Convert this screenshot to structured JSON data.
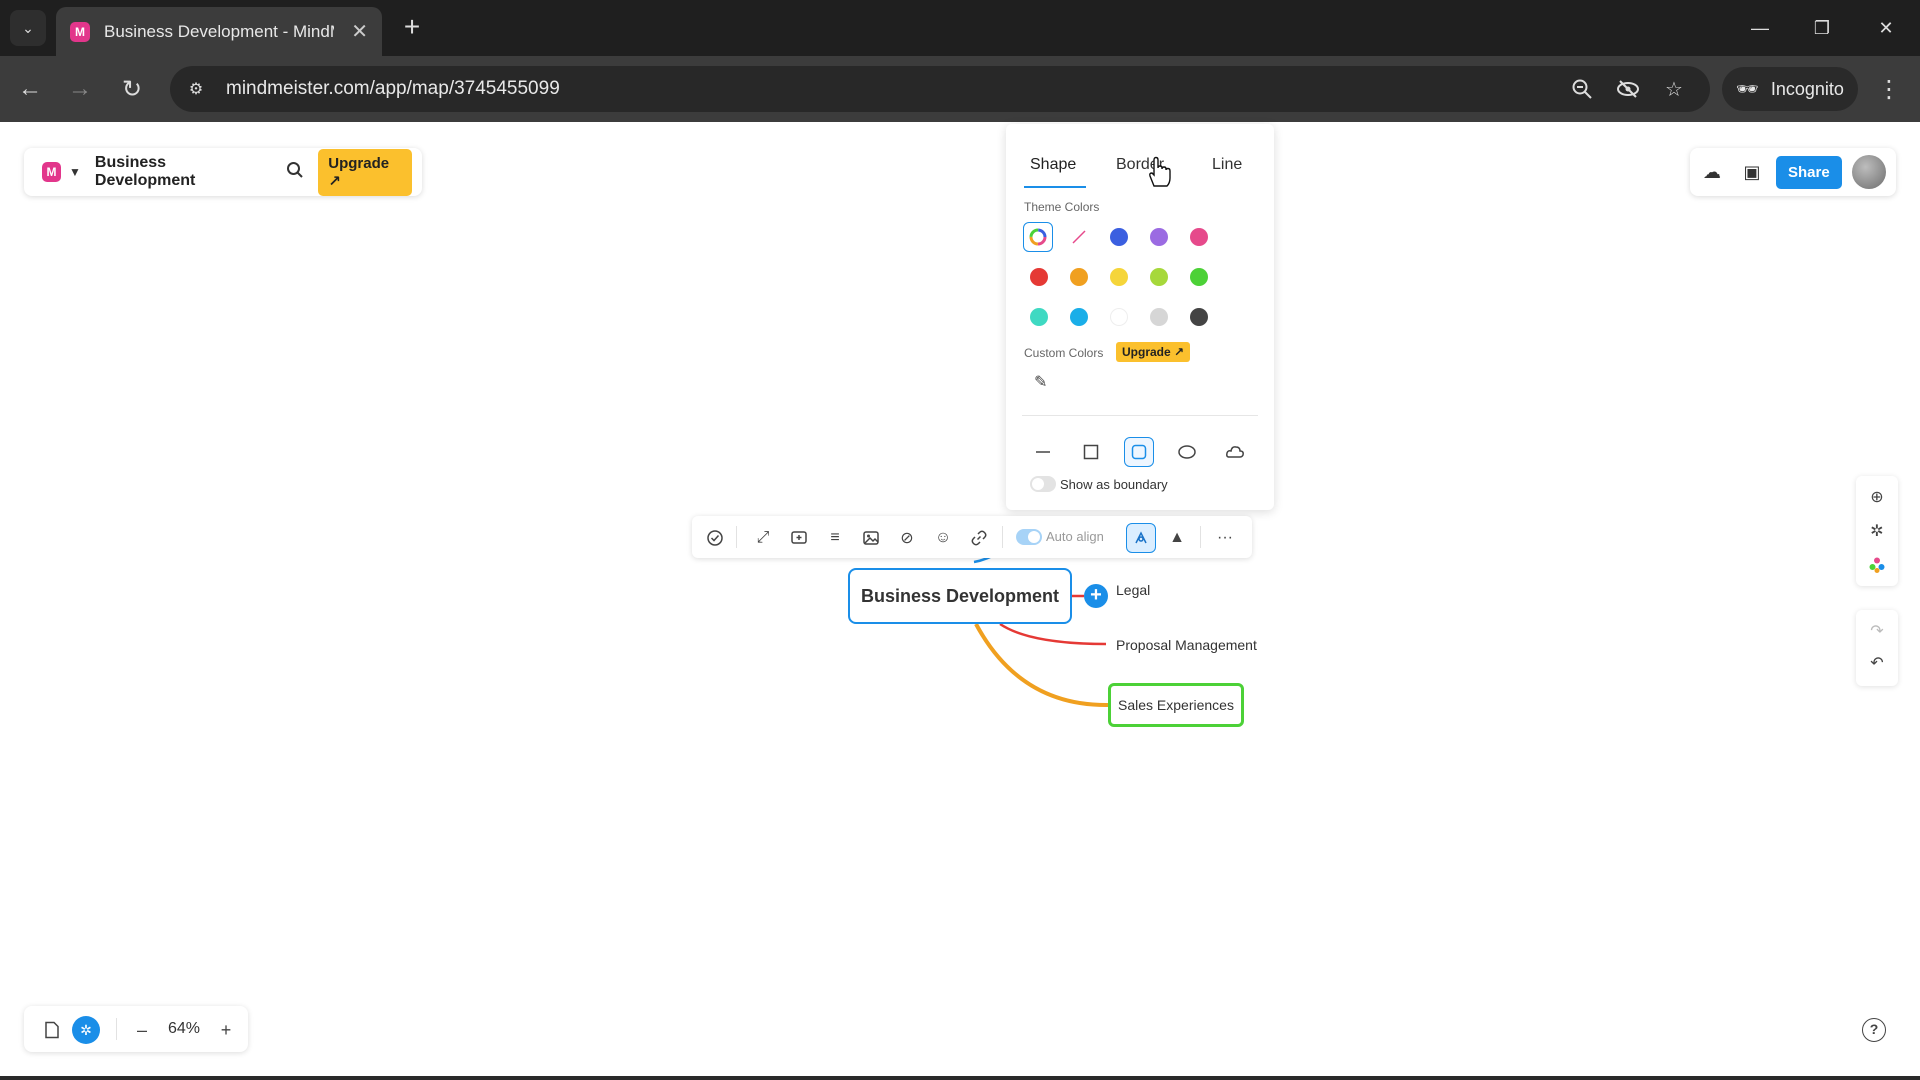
{
  "browser": {
    "tab_title": "Business Development - MindMeister",
    "url": "mindmeister.com/app/map/3745455099",
    "incognito_label": "Incognito",
    "new_tab_symbol": "+",
    "close_symbol": "✕"
  },
  "header": {
    "app_initial": "M",
    "map_title": "Business Development",
    "upgrade_label": "Upgrade ↗",
    "share_label": "Share"
  },
  "style_panel": {
    "tabs": [
      "Shape",
      "Border",
      "Line"
    ],
    "active_tab": "Shape",
    "theme_colors_label": "Theme Colors",
    "custom_colors_label": "Custom Colors",
    "custom_upgrade_label": "Upgrade ↗",
    "show_as_boundary_label": "Show as boundary",
    "show_as_boundary": false,
    "selected_shape": "rounded-rectangle",
    "colors": {
      "blue": "#3b5fe0",
      "purple": "#9b6be2",
      "pink": "#e64a8b",
      "red": "#e53935",
      "orange": "#f0a020",
      "yellow": "#f5d53a",
      "lime": "#a6d83b",
      "green": "#4cd137",
      "teal": "#3fd9c2",
      "sky": "#1aaee8",
      "white": "#ffffff",
      "light_gray": "#d6d6d6",
      "dark_gray": "#444444"
    }
  },
  "node_toolbar": {
    "auto_align_label": "Auto align",
    "auto_align": true
  },
  "map": {
    "root": "Business Development",
    "children": [
      "Legal",
      "Proposal Management",
      "Sales Experiences"
    ],
    "branch_colors": {
      "legal": "#1a8ee8",
      "proposal": "#e53935",
      "sales": "#f0a020",
      "sales_border": "#4cd137"
    }
  },
  "zoom": {
    "minus": "–",
    "value": "64%",
    "plus": "+"
  }
}
